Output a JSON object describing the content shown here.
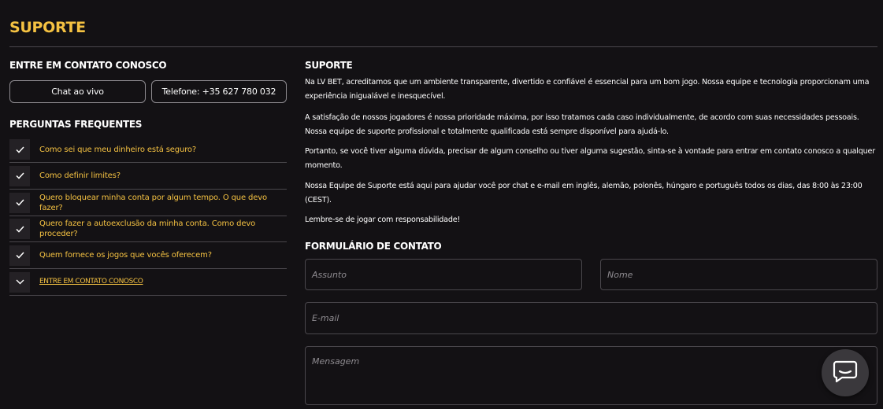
{
  "page": {
    "title": "SUPORTE"
  },
  "contact": {
    "heading": "ENTRE EM CONTATO CONOSCO",
    "chat_label": "Chat ao vivo",
    "phone_label": "Telefone: +35 627 780 032"
  },
  "faq": {
    "heading": "PERGUNTAS FREQUENTES",
    "items": [
      {
        "label": "Como sei que meu dinheiro está seguro?",
        "icon": "check-icon"
      },
      {
        "label": "Como definir limites?",
        "icon": "check-icon"
      },
      {
        "label": "Quero bloquear minha conta por algum tempo. O que devo fazer?",
        "icon": "check-icon"
      },
      {
        "label": "Quero fazer a autoexclusão da minha conta. Como devo proceder?",
        "icon": "check-icon"
      },
      {
        "label": "Quem fornece os jogos que vocês oferecem?",
        "icon": "check-icon"
      },
      {
        "label": "ENTRE EM CONTATO CONOSCO",
        "icon": "chevron-down-icon"
      }
    ]
  },
  "support": {
    "heading": "SUPORTE",
    "paragraphs": [
      "Na LV BET, acreditamos que um ambiente transparente, divertido e confiável é essencial para um bom jogo. Nossa equipe e tecnologia proporcionam uma experiência inigualável e inesquecível.",
      "A satisfação de nossos jogadores é nossa prioridade máxima, por isso tratamos cada caso individualmente, de acordo com suas necessidades pessoais. Nossa equipe de suporte profissional e totalmente qualificada está sempre disponível para ajudá-lo.",
      "Portanto, se você tiver alguma dúvida, precisar de algum conselho ou tiver alguma sugestão, sinta-se à vontade para entrar em contato conosco a qualquer momento.",
      "Nossa Equipe de Suporte está aqui para ajudar você por chat e e-mail em inglês, alemão, polonês, húngaro e português todos os dias, das 8:00 às 23:00 (CEST).",
      "Lembre-se de jogar com responsabilidade!"
    ]
  },
  "form": {
    "heading": "FORMULÁRIO DE CONTATO",
    "subject_placeholder": "Assunto",
    "name_placeholder": "Nome",
    "email_placeholder": "E-mail",
    "message_placeholder": "Mensagem"
  },
  "colors": {
    "background": "#131114",
    "accent": "#f5c242",
    "border": "#4a474c"
  },
  "chat_widget": {
    "icon": "chat-bubble-icon"
  }
}
